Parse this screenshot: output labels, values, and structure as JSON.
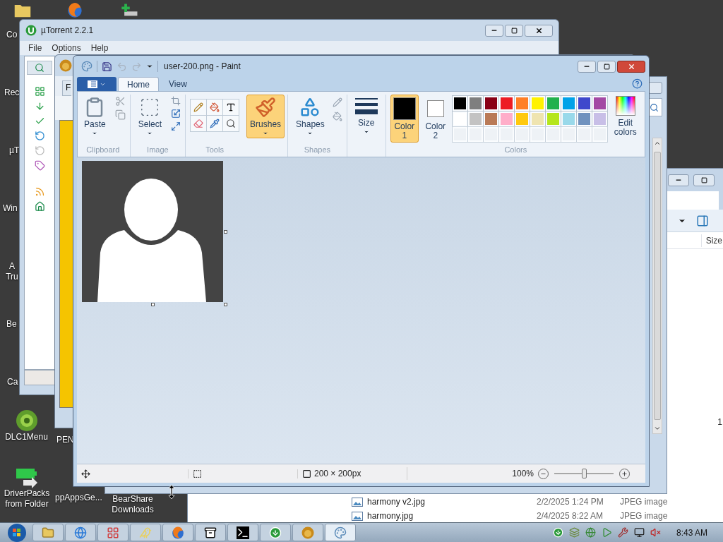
{
  "desktop": {
    "icons": [
      {
        "kind": "folder"
      },
      {
        "kind": "browser"
      },
      {
        "kind": "install"
      },
      {
        "kind": "none",
        "label": "Co"
      },
      {
        "kind": "none",
        "label": "Rec"
      },
      {
        "kind": "none",
        "label": "µT"
      },
      {
        "kind": "none",
        "label": "Win"
      },
      {
        "kind": "none",
        "label": "A Tru"
      },
      {
        "kind": "none",
        "label": "Be"
      },
      {
        "kind": "none",
        "label": "Ca"
      },
      {
        "kind": "disc",
        "label": "DLC1Menu"
      },
      {
        "kind": "none",
        "label": "PEN"
      },
      {
        "kind": "battery",
        "label": "DriverPacks from Folder"
      },
      {
        "kind": "none",
        "label": "ppAppsGe..."
      },
      {
        "kind": "none",
        "label": "BearShare Downloads"
      }
    ]
  },
  "explorer": {
    "column": "Size",
    "size_cell": "1",
    "rows": [
      {
        "name": "harmony v2.jpg",
        "date": "2/2/2025 1:24 PM",
        "type": "JPEG image"
      },
      {
        "name": "harmony.jpg",
        "date": "2/4/2025 8:22 AM",
        "type": "JPEG image"
      }
    ]
  },
  "utorrent": {
    "title": "µTorrent 2.2.1",
    "menu": [
      "File",
      "Options",
      "Help"
    ]
  },
  "bearshare": {
    "tab": "F"
  },
  "paint": {
    "title": "user-200.png - Paint",
    "quick_access": [
      {
        "kind": "save",
        "disabled": false
      },
      {
        "kind": "undo",
        "disabled": true
      },
      {
        "kind": "redo",
        "disabled": true
      }
    ],
    "tabs": [
      {
        "label": "Home",
        "selected": true
      },
      {
        "label": "View",
        "selected": false
      }
    ],
    "clipboard": {
      "label": "Clipboard",
      "paste": "Paste",
      "cut_disabled": true,
      "copy_disabled": true
    },
    "image": {
      "label": "Image",
      "select": "Select"
    },
    "tools": {
      "label": "Tools"
    },
    "brushes": {
      "label": "Brushes",
      "selected": true
    },
    "shapes": {
      "label": "Shapes",
      "button": "Shapes"
    },
    "size": {
      "label": "Size"
    },
    "colors": {
      "label": "Colors",
      "edit": "Edit colors",
      "color1": {
        "label": "Color 1",
        "color": "#000000",
        "selected": true
      },
      "color2": {
        "label": "Color 2",
        "color": "#ffffff",
        "selected": false
      },
      "palette": [
        {
          "color": "#000000"
        },
        {
          "color": "#7f7f7f"
        },
        {
          "color": "#880015"
        },
        {
          "color": "#ed1c24"
        },
        {
          "color": "#ff7f27"
        },
        {
          "color": "#fff200"
        },
        {
          "color": "#22b14c"
        },
        {
          "color": "#00a2e8"
        },
        {
          "color": "#3f48cc"
        },
        {
          "color": "#a349a4"
        },
        {
          "color": "#ffffff"
        },
        {
          "color": "#c3c3c3"
        },
        {
          "color": "#b97a57"
        },
        {
          "color": "#ffaec9"
        },
        {
          "color": "#ffc90e"
        },
        {
          "color": "#efe4b0"
        },
        {
          "color": "#b5e61d"
        },
        {
          "color": "#99d9ea"
        },
        {
          "color": "#7092be"
        },
        {
          "color": "#c8bfe7"
        }
      ]
    },
    "status": {
      "dimensions": "200 × 200px",
      "zoom": "100%",
      "level": 0.5
    }
  },
  "taskbar": {
    "clock": "8:43 AM",
    "items": [
      {
        "kind": "folder",
        "selected": false
      },
      {
        "kind": "globe",
        "selected": false
      },
      {
        "kind": "grid",
        "selected": false
      },
      {
        "kind": "bird",
        "selected": false
      },
      {
        "kind": "browser",
        "selected": false
      },
      {
        "kind": "archive",
        "selected": false
      },
      {
        "kind": "terminal",
        "selected": false
      },
      {
        "kind": "torrent",
        "selected": false
      },
      {
        "kind": "emblem",
        "selected": false
      },
      {
        "kind": "paint",
        "selected": true
      }
    ]
  }
}
